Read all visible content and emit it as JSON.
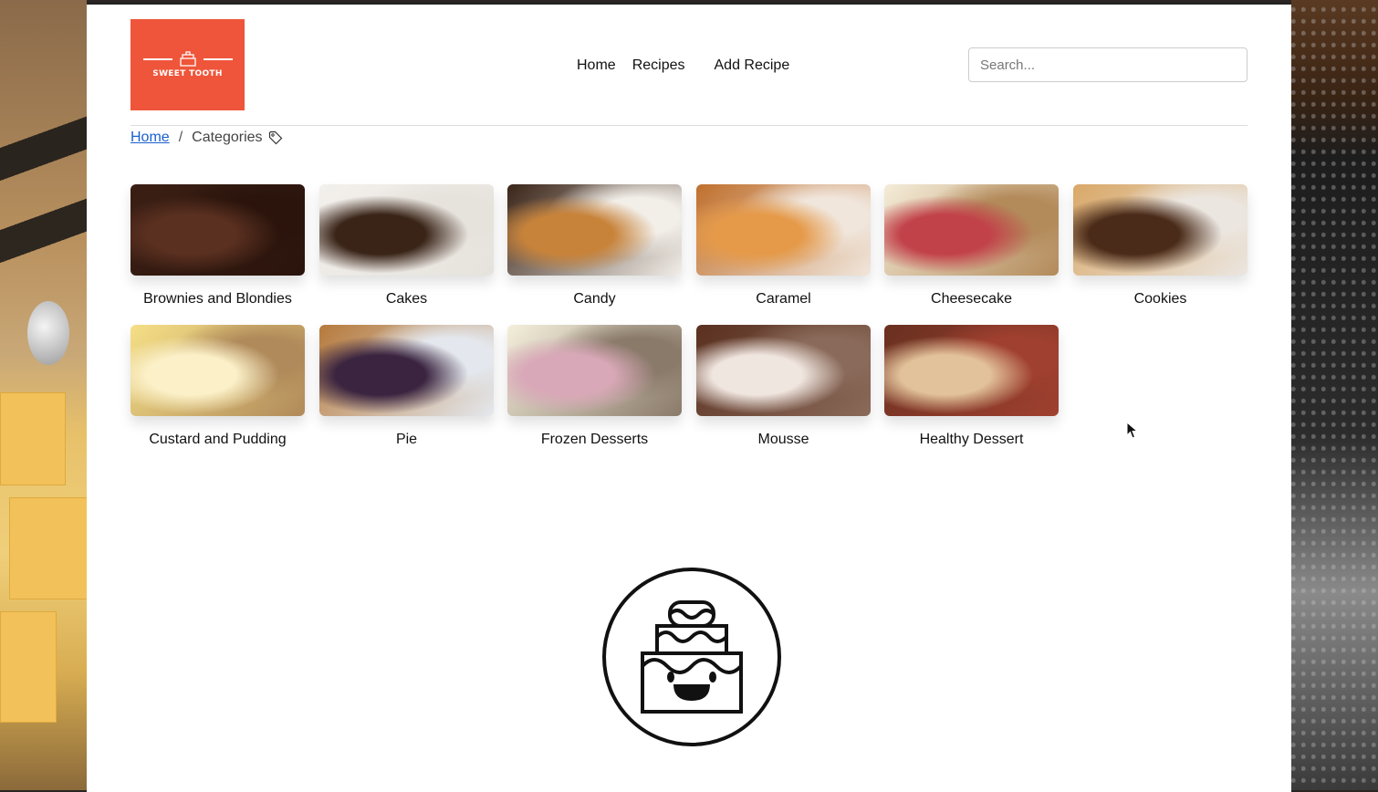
{
  "header": {
    "logo_text": "SWEET TOOTH",
    "nav": {
      "home": "Home",
      "recipes": "Recipes",
      "add_recipe": "Add Recipe"
    },
    "search": {
      "placeholder": "Search...",
      "value": ""
    }
  },
  "breadcrumb": {
    "home": "Home",
    "separator": "/",
    "current": "Categories"
  },
  "categories": [
    {
      "label": "Brownies and Blondies",
      "palette": [
        "#3b1f14",
        "#5a3020",
        "#2a140c"
      ]
    },
    {
      "label": "Cakes",
      "palette": [
        "#f3f0ec",
        "#3a2418",
        "#e6e2dc"
      ]
    },
    {
      "label": "Candy",
      "palette": [
        "#3a2418",
        "#c8833a",
        "#f2eee8"
      ]
    },
    {
      "label": "Caramel",
      "palette": [
        "#c0702e",
        "#e59a4a",
        "#f0e6dc"
      ]
    },
    {
      "label": "Cheesecake",
      "palette": [
        "#f4ecd8",
        "#c2424a",
        "#b38a5a"
      ]
    },
    {
      "label": "Cookies",
      "palette": [
        "#d9a868",
        "#4a2a18",
        "#ebe6e0"
      ]
    },
    {
      "label": "Custard and Pudding",
      "palette": [
        "#f5df86",
        "#fbf0c8",
        "#b08a5a"
      ]
    },
    {
      "label": "Pie",
      "palette": [
        "#b67a3c",
        "#3a2440",
        "#e4e8ee"
      ]
    },
    {
      "label": "Frozen Desserts",
      "palette": [
        "#f4efdc",
        "#d9a8b8",
        "#8a7a6a"
      ]
    },
    {
      "label": "Mousse",
      "palette": [
        "#5a3020",
        "#f0e6e0",
        "#8a6a5a"
      ]
    },
    {
      "label": "Healthy Dessert",
      "palette": [
        "#6a3020",
        "#e2c29a",
        "#a04030"
      ]
    }
  ],
  "colors": {
    "brand": "#ef553a",
    "link": "#1a5fd0"
  }
}
